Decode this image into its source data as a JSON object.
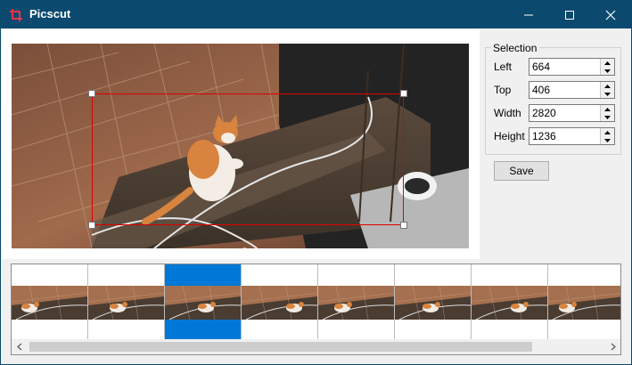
{
  "window": {
    "title": "Picscut",
    "titlebar_color": "#0b4a6e",
    "controls": [
      "minimize-icon",
      "maximize-icon",
      "close-icon"
    ]
  },
  "selection": {
    "group_label": "Selection",
    "fields": [
      {
        "label": "Left",
        "value": "664"
      },
      {
        "label": "Top",
        "value": "406"
      },
      {
        "label": "Width",
        "value": "2820"
      },
      {
        "label": "Height",
        "value": "1236"
      }
    ],
    "box_color": "#e00000"
  },
  "save_label": "Save",
  "thumbnails": {
    "count": 8,
    "selected_index": 2,
    "selected_color": "#0078d7"
  },
  "scrollbar": {
    "left_arrow": "chevron-left-icon",
    "right_arrow": "chevron-right-icon"
  }
}
